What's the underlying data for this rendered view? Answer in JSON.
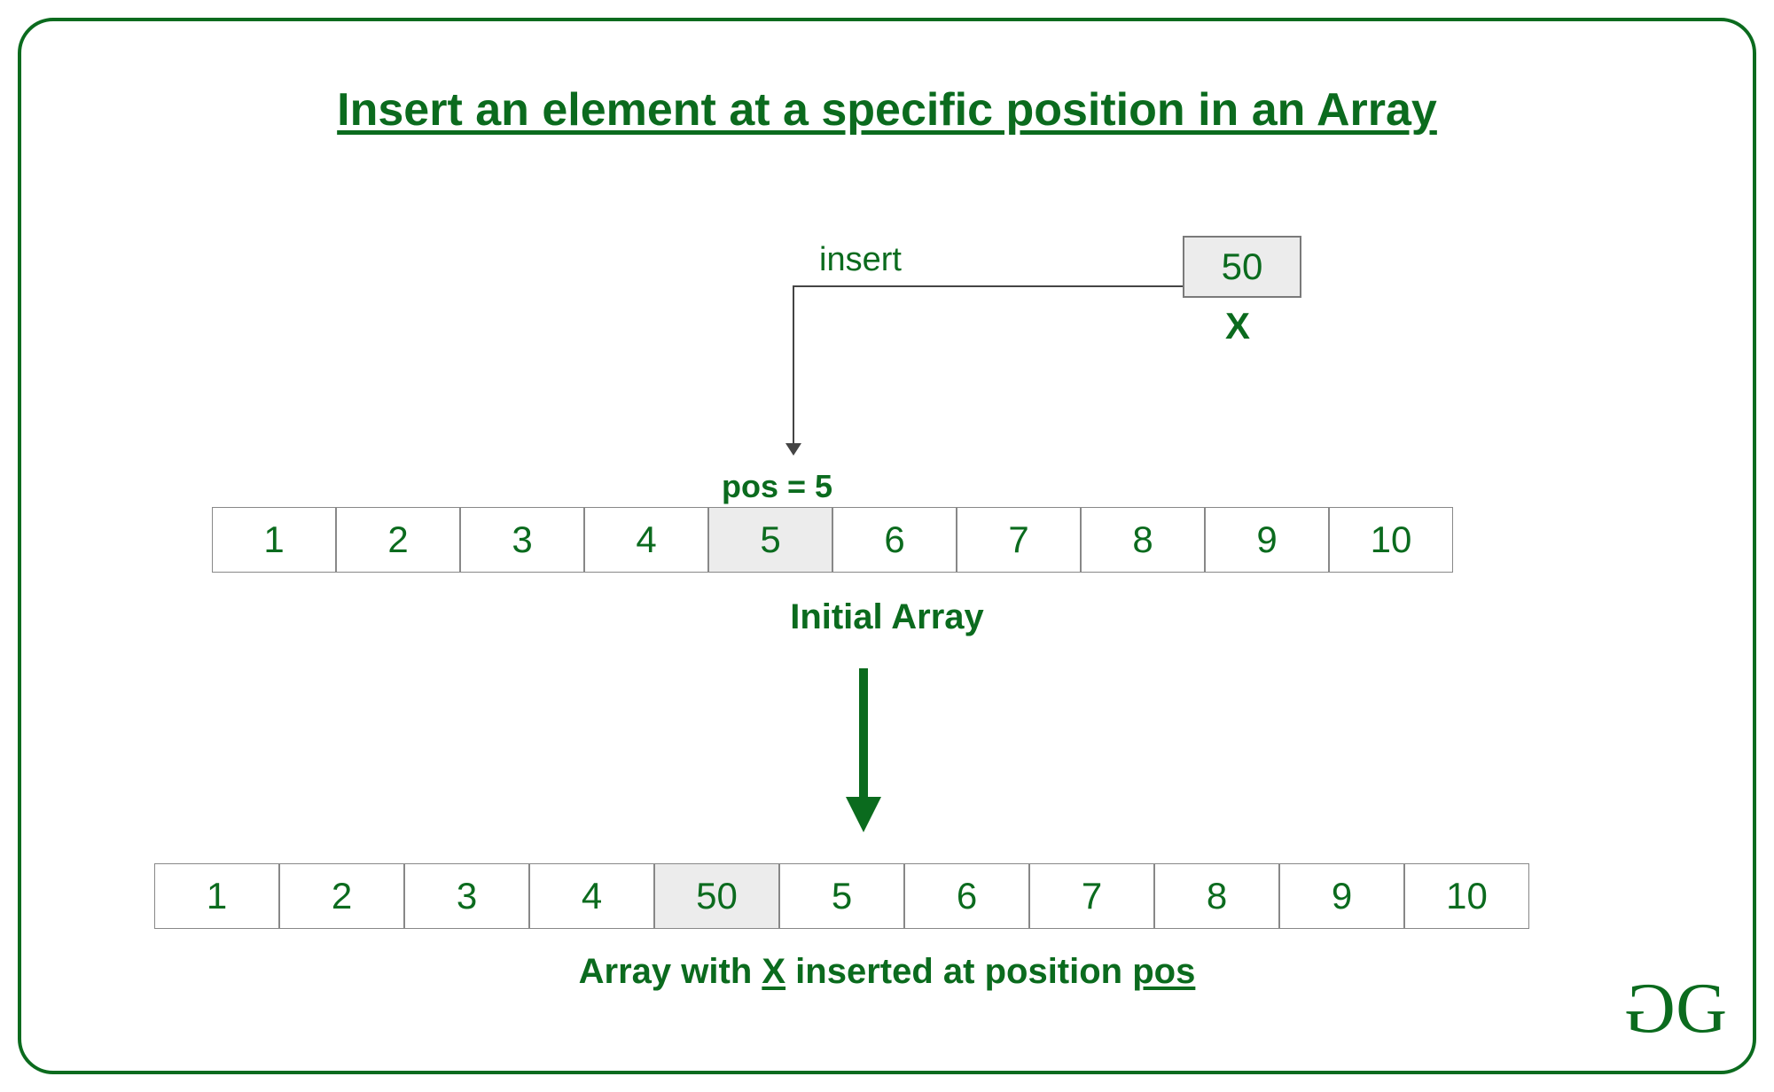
{
  "title": "Insert an element at a specific position in an Array",
  "insert_label": "insert",
  "x_value": "50",
  "x_label": "X",
  "pos_label": "pos = 5",
  "initial_array": [
    "1",
    "2",
    "3",
    "4",
    "5",
    "6",
    "7",
    "8",
    "9",
    "10"
  ],
  "initial_highlight_index": 4,
  "initial_caption": "Initial Array",
  "result_array": [
    "1",
    "2",
    "3",
    "4",
    "50",
    "5",
    "6",
    "7",
    "8",
    "9",
    "10"
  ],
  "result_highlight_index": 4,
  "result_caption_parts": {
    "p1": "Array with ",
    "x": "X",
    "p2": " inserted at position ",
    "pos": "pos"
  },
  "logo": {
    "g1": "G",
    "g2": "G"
  }
}
